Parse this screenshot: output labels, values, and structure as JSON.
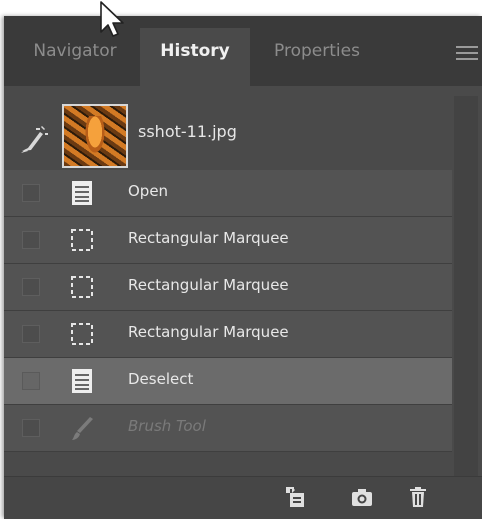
{
  "tabs": [
    {
      "label": "Navigator",
      "active": false
    },
    {
      "label": "History",
      "active": true
    },
    {
      "label": "Properties",
      "active": false
    }
  ],
  "snapshot": {
    "label": "sshot-11.jpg"
  },
  "history_items": [
    {
      "label": "Open",
      "icon": "document-icon",
      "state": "normal"
    },
    {
      "label": "Rectangular Marquee",
      "icon": "rectangular-marquee-icon",
      "state": "normal"
    },
    {
      "label": "Rectangular Marquee",
      "icon": "rectangular-marquee-icon",
      "state": "normal"
    },
    {
      "label": "Rectangular Marquee",
      "icon": "rectangular-marquee-icon",
      "state": "normal"
    },
    {
      "label": "Deselect",
      "icon": "document-icon",
      "state": "selected"
    },
    {
      "label": "Brush Tool",
      "icon": "brush-icon",
      "state": "disabled"
    }
  ],
  "bottom_actions": [
    {
      "name": "new-document-from-state-icon"
    },
    {
      "name": "camera-icon"
    },
    {
      "name": "trash-icon"
    }
  ],
  "colors": {
    "panel_bg": "#4a4a4a",
    "row_bg": "#535353",
    "row_selected_bg": "#6b6b6b",
    "text": "#e8e8e8"
  }
}
